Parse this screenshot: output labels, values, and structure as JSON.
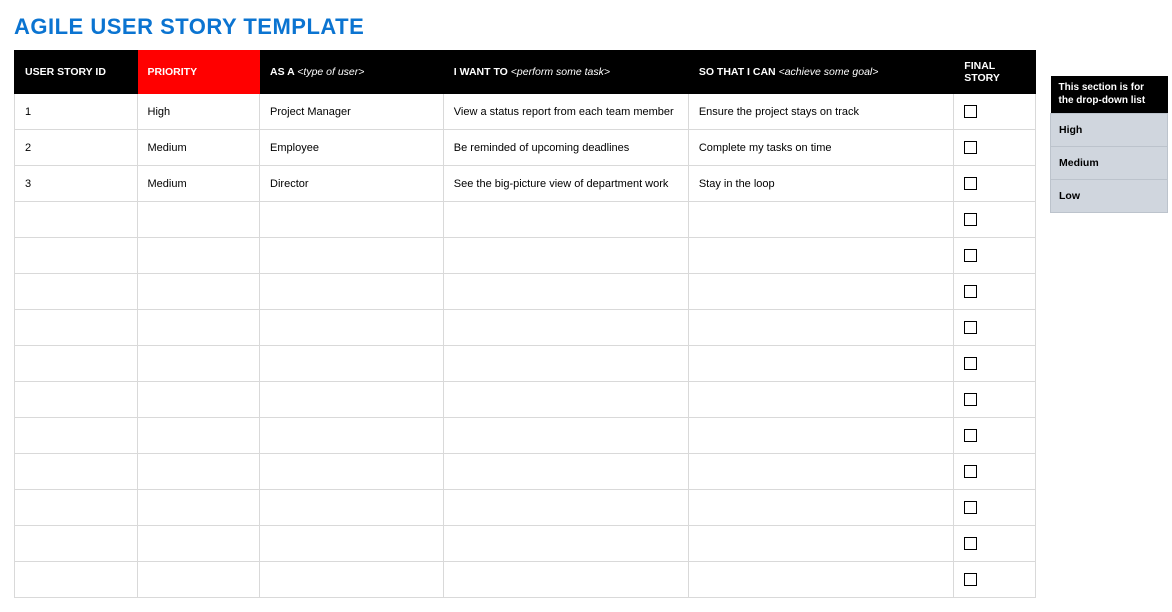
{
  "title": "AGILE USER STORY TEMPLATE",
  "headers": {
    "userStoryId": "USER STORY ID",
    "priority": "PRIORITY",
    "asA_prefix": "AS A ",
    "asA_hint": "<type of user>",
    "iWantTo_prefix": "I WANT TO ",
    "iWantTo_hint": "<perform some task>",
    "soThat_prefix": "SO THAT I CAN ",
    "soThat_hint": "<achieve some goal>",
    "finalStory": "FINAL STORY"
  },
  "rows": [
    {
      "id": "1",
      "priority": "High",
      "asA": "Project Manager",
      "iWantTo": "View a status report from each team member",
      "soThat": "Ensure the project stays on track",
      "final": false
    },
    {
      "id": "2",
      "priority": "Medium",
      "asA": "Employee",
      "iWantTo": "Be reminded of upcoming deadlines",
      "soThat": "Complete my tasks on time",
      "final": false
    },
    {
      "id": "3",
      "priority": "Medium",
      "asA": "Director",
      "iWantTo": "See the big-picture view of department work",
      "soThat": "Stay in the loop",
      "final": false
    },
    {
      "id": "",
      "priority": "",
      "asA": "",
      "iWantTo": "",
      "soThat": "",
      "final": false
    },
    {
      "id": "",
      "priority": "",
      "asA": "",
      "iWantTo": "",
      "soThat": "",
      "final": false
    },
    {
      "id": "",
      "priority": "",
      "asA": "",
      "iWantTo": "",
      "soThat": "",
      "final": false
    },
    {
      "id": "",
      "priority": "",
      "asA": "",
      "iWantTo": "",
      "soThat": "",
      "final": false
    },
    {
      "id": "",
      "priority": "",
      "asA": "",
      "iWantTo": "",
      "soThat": "",
      "final": false
    },
    {
      "id": "",
      "priority": "",
      "asA": "",
      "iWantTo": "",
      "soThat": "",
      "final": false
    },
    {
      "id": "",
      "priority": "",
      "asA": "",
      "iWantTo": "",
      "soThat": "",
      "final": false
    },
    {
      "id": "",
      "priority": "",
      "asA": "",
      "iWantTo": "",
      "soThat": "",
      "final": false
    },
    {
      "id": "",
      "priority": "",
      "asA": "",
      "iWantTo": "",
      "soThat": "",
      "final": false
    },
    {
      "id": "",
      "priority": "",
      "asA": "",
      "iWantTo": "",
      "soThat": "",
      "final": false
    },
    {
      "id": "",
      "priority": "",
      "asA": "",
      "iWantTo": "",
      "soThat": "",
      "final": false
    }
  ],
  "dropdown": {
    "title": "This section is for the drop-down list",
    "options": [
      "High",
      "Medium",
      "Low"
    ]
  }
}
